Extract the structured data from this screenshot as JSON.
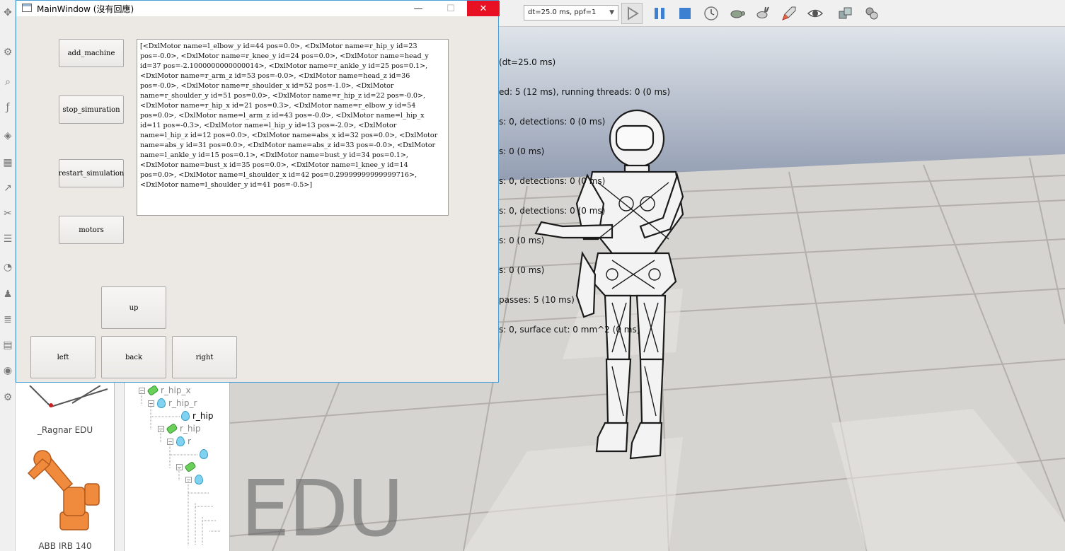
{
  "main_window": {
    "title": "MainWindow (沒有回應)",
    "controls": {
      "minimize": "—",
      "maximize": "☐",
      "close": "✕"
    },
    "buttons": {
      "add_machine": "add_machine",
      "stop_simulation": "stop_simuration",
      "restart_simulation": "restart_simulation",
      "motors": "motors",
      "up": "up",
      "left": "left",
      "back": "back",
      "right": "right"
    },
    "output_text": "[<DxlMotor name=l_elbow_y id=44 pos=0.0>, <DxlMotor name=r_hip_y id=23 pos=-0.0>, <DxlMotor name=r_knee_y id=24 pos=0.0>, <DxlMotor name=head_y id=37 pos=-2.1000000000000014>, <DxlMotor name=r_ankle_y id=25 pos=0.1>, <DxlMotor name=r_arm_z id=53 pos=-0.0>, <DxlMotor name=head_z id=36 pos=-0.0>, <DxlMotor name=r_shoulder_x id=52 pos=-1.0>, <DxlMotor name=r_shoulder_y id=51 pos=0.0>, <DxlMotor name=r_hip_z id=22 pos=-0.0>, <DxlMotor name=r_hip_x id=21 pos=0.3>, <DxlMotor name=r_elbow_y id=54 pos=0.0>, <DxlMotor name=l_arm_z id=43 pos=-0.0>, <DxlMotor name=l_hip_x id=11 pos=-0.3>, <DxlMotor name=l_hip_y id=13 pos=-2.0>, <DxlMotor name=l_hip_z id=12 pos=0.0>, <DxlMotor name=abs_x id=32 pos=0.0>, <DxlMotor name=abs_y id=31 pos=0.0>, <DxlMotor name=abs_z id=33 pos=-0.0>, <DxlMotor name=l_ankle_y id=15 pos=0.1>, <DxlMotor name=bust_y id=34 pos=0.1>, <DxlMotor name=bust_x id=35 pos=0.0>, <DxlMotor name=l_knee_y id=14 pos=0.0>, <DxlMotor name=l_shoulder_x id=42 pos=0.29999999999999716>, <DxlMotor name=l_shoulder_y id=41 pos=-0.5>]"
  },
  "toolbar": {
    "dt_select": "dt=25.0 ms, ppf=1",
    "icons": [
      "play-icon",
      "pause-icon",
      "stop-icon",
      "realtime-icon",
      "slow-turtle-icon",
      "fast-rabbit-icon",
      "rocket-icon",
      "eye-icon",
      "cubes-icon",
      "multi-robot-icon"
    ]
  },
  "viewport": {
    "status_lines": [
      "(dt=25.0 ms)",
      "ed: 5 (12 ms), running threads: 0 (0 ms)",
      "s: 0, detections: 0 (0 ms)",
      "s: 0 (0 ms)",
      "s: 0, detections: 0 (0 ms)",
      "s: 0, detections: 0 (0 ms)",
      "s: 0 (0 ms)",
      "s: 0 (0 ms)",
      "passes: 5 (10 ms)",
      "s: 0, surface cut: 0 mm^2 (0 ms)"
    ],
    "watermark": "EDU"
  },
  "model_browser": {
    "items": [
      {
        "label": "_Ragnar EDU"
      },
      {
        "label": "ABB IRB 140"
      }
    ]
  },
  "scene_tree": {
    "rows": [
      {
        "label": "r_hip_x",
        "kind": "joint"
      },
      {
        "label": "r_hip_r",
        "kind": "shape"
      },
      {
        "label": "r_hip",
        "kind": "shape"
      },
      {
        "label": "r_hip",
        "kind": "joint"
      },
      {
        "label": "r",
        "kind": "shape"
      },
      {
        "label": "",
        "kind": "shape"
      },
      {
        "label": "",
        "kind": "joint"
      },
      {
        "label": "",
        "kind": "shape"
      }
    ]
  }
}
